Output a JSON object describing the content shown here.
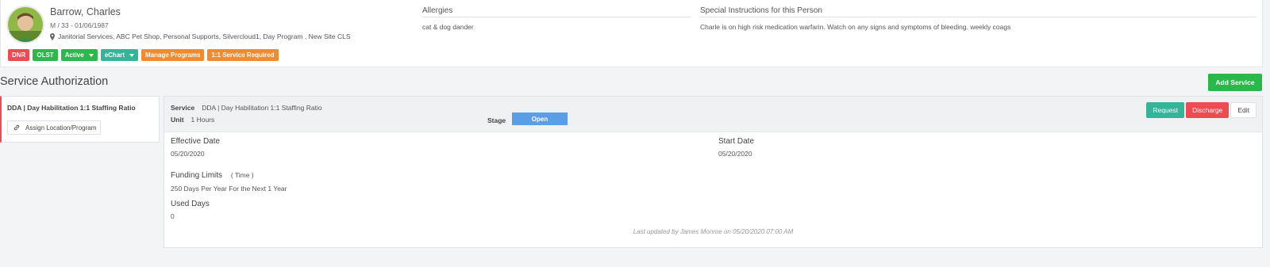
{
  "person": {
    "name": "Barrow, Charles",
    "meta": "M  /  33 - 01/06/1987",
    "locations": "Janitorial Services, ABC Pet Shop, Personal Supports, Silvercloud1, Day Program , New Site CLS",
    "badges": {
      "dnr": "DNR",
      "olst": "OLST",
      "active": "Active",
      "echart": "eChart",
      "manage_programs": "Manage Programs",
      "service_required": "1:1 Service Required"
    },
    "allergies_label": "Allergies",
    "allergies_value": "cat & dog dander",
    "instructions_label": "Special Instructions for this Person",
    "instructions_value": "Charle is on high risk medication warfarin. Watch on any signs and symptoms of bleeding. weekly coags"
  },
  "section": {
    "title": "Service Authorization",
    "add_service_label": "Add Service"
  },
  "service_list": {
    "items": [
      {
        "title": "DDA | Day Habilitation 1:1 Staffing Ratio",
        "assign_label": "Assign Location/Program"
      }
    ]
  },
  "detail": {
    "service_label": "Service",
    "service_value": "DDA | Day Habilitation 1:1 Staffing Ratio",
    "unit_label": "Unit",
    "unit_value": "1  Hours",
    "stage_label": "Stage",
    "stage_value": "Open",
    "actions": {
      "request": "Request",
      "discharge": "Discharge",
      "edit": "Edit"
    },
    "effective_date_label": "Effective Date",
    "effective_date_value": "05/20/2020",
    "start_date_label": "Start Date",
    "start_date_value": "05/20/2020",
    "funding_limits_label": "Funding Limits",
    "funding_limits_unit": "( Time )",
    "funding_limits_value": "250 Days Per Year For the Next 1 Year",
    "used_days_label": "Used  Days",
    "used_days_value": "0",
    "last_updated": "Last updated by James Monroe on 05/20/2020 07:00 AM"
  },
  "colors": {
    "danger": "#ec4b52",
    "success": "#2cb84a",
    "teal": "#34b498",
    "orange": "#f28a2f",
    "stage_blue": "#5a9ee8"
  }
}
